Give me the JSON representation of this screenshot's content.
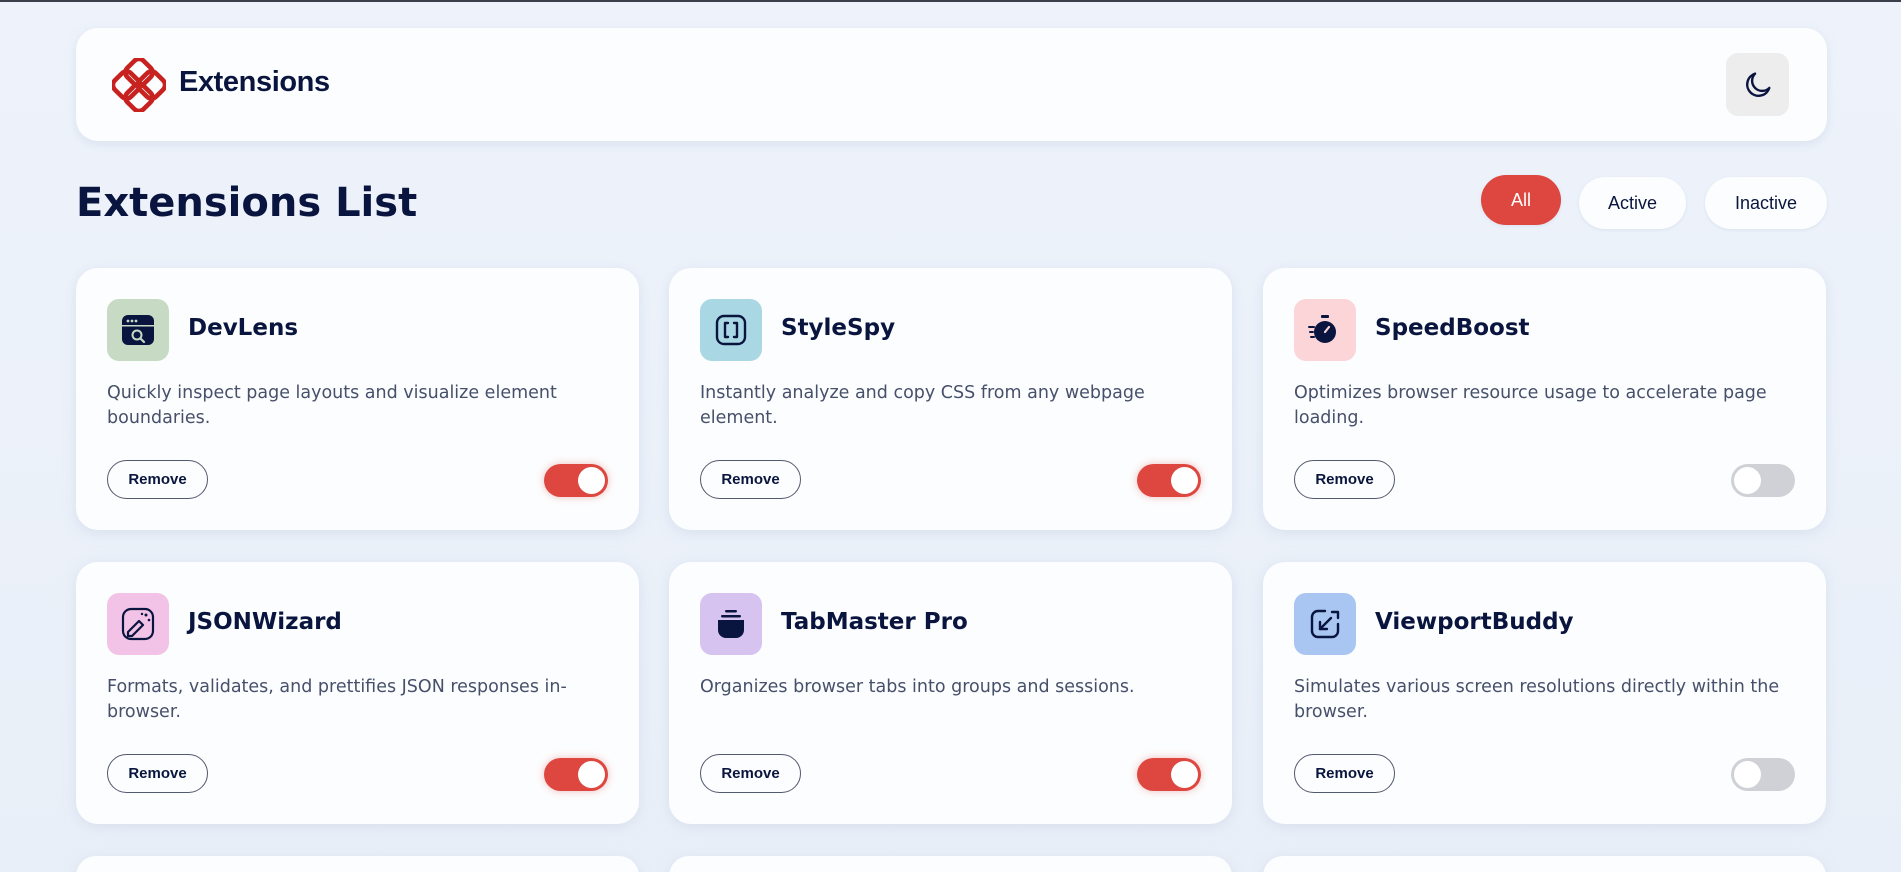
{
  "header": {
    "brand": "Extensions",
    "theme_toggle_icon": "moon-icon"
  },
  "main": {
    "title": "Extensions List",
    "filters": [
      {
        "label": "All",
        "selected": true
      },
      {
        "label": "Active",
        "selected": false
      },
      {
        "label": "Inactive",
        "selected": false
      }
    ],
    "remove_label": "Remove",
    "extensions": [
      {
        "name": "DevLens",
        "description": "Quickly inspect page layouts and visualize element boundaries.",
        "active": true,
        "icon": "devlens-icon",
        "icon_bg": "#c7dbc4"
      },
      {
        "name": "StyleSpy",
        "description": "Instantly analyze and copy CSS from any webpage element.",
        "active": true,
        "icon": "stylespy-icon",
        "icon_bg": "#aad7e4"
      },
      {
        "name": "SpeedBoost",
        "description": "Optimizes browser resource usage to accelerate page loading.",
        "active": false,
        "icon": "speedboost-icon",
        "icon_bg": "#fcd5d8"
      },
      {
        "name": "JSONWizard",
        "description": "Formats, validates, and prettifies JSON responses in-browser.",
        "active": true,
        "icon": "jsonwizard-icon",
        "icon_bg": "#f2c3e6"
      },
      {
        "name": "TabMaster Pro",
        "description": "Organizes browser tabs into groups and sessions.",
        "active": true,
        "icon": "tabmaster-icon",
        "icon_bg": "#d7c3f0"
      },
      {
        "name": "ViewportBuddy",
        "description": "Simulates various screen resolutions directly within the browser.",
        "active": false,
        "icon": "viewportbuddy-icon",
        "icon_bg": "#a9c6f3"
      }
    ]
  },
  "colors": {
    "accent": "#de473f",
    "text": "#09153e",
    "muted_text": "#46506a",
    "toggle_off": "#d0d1d6"
  }
}
